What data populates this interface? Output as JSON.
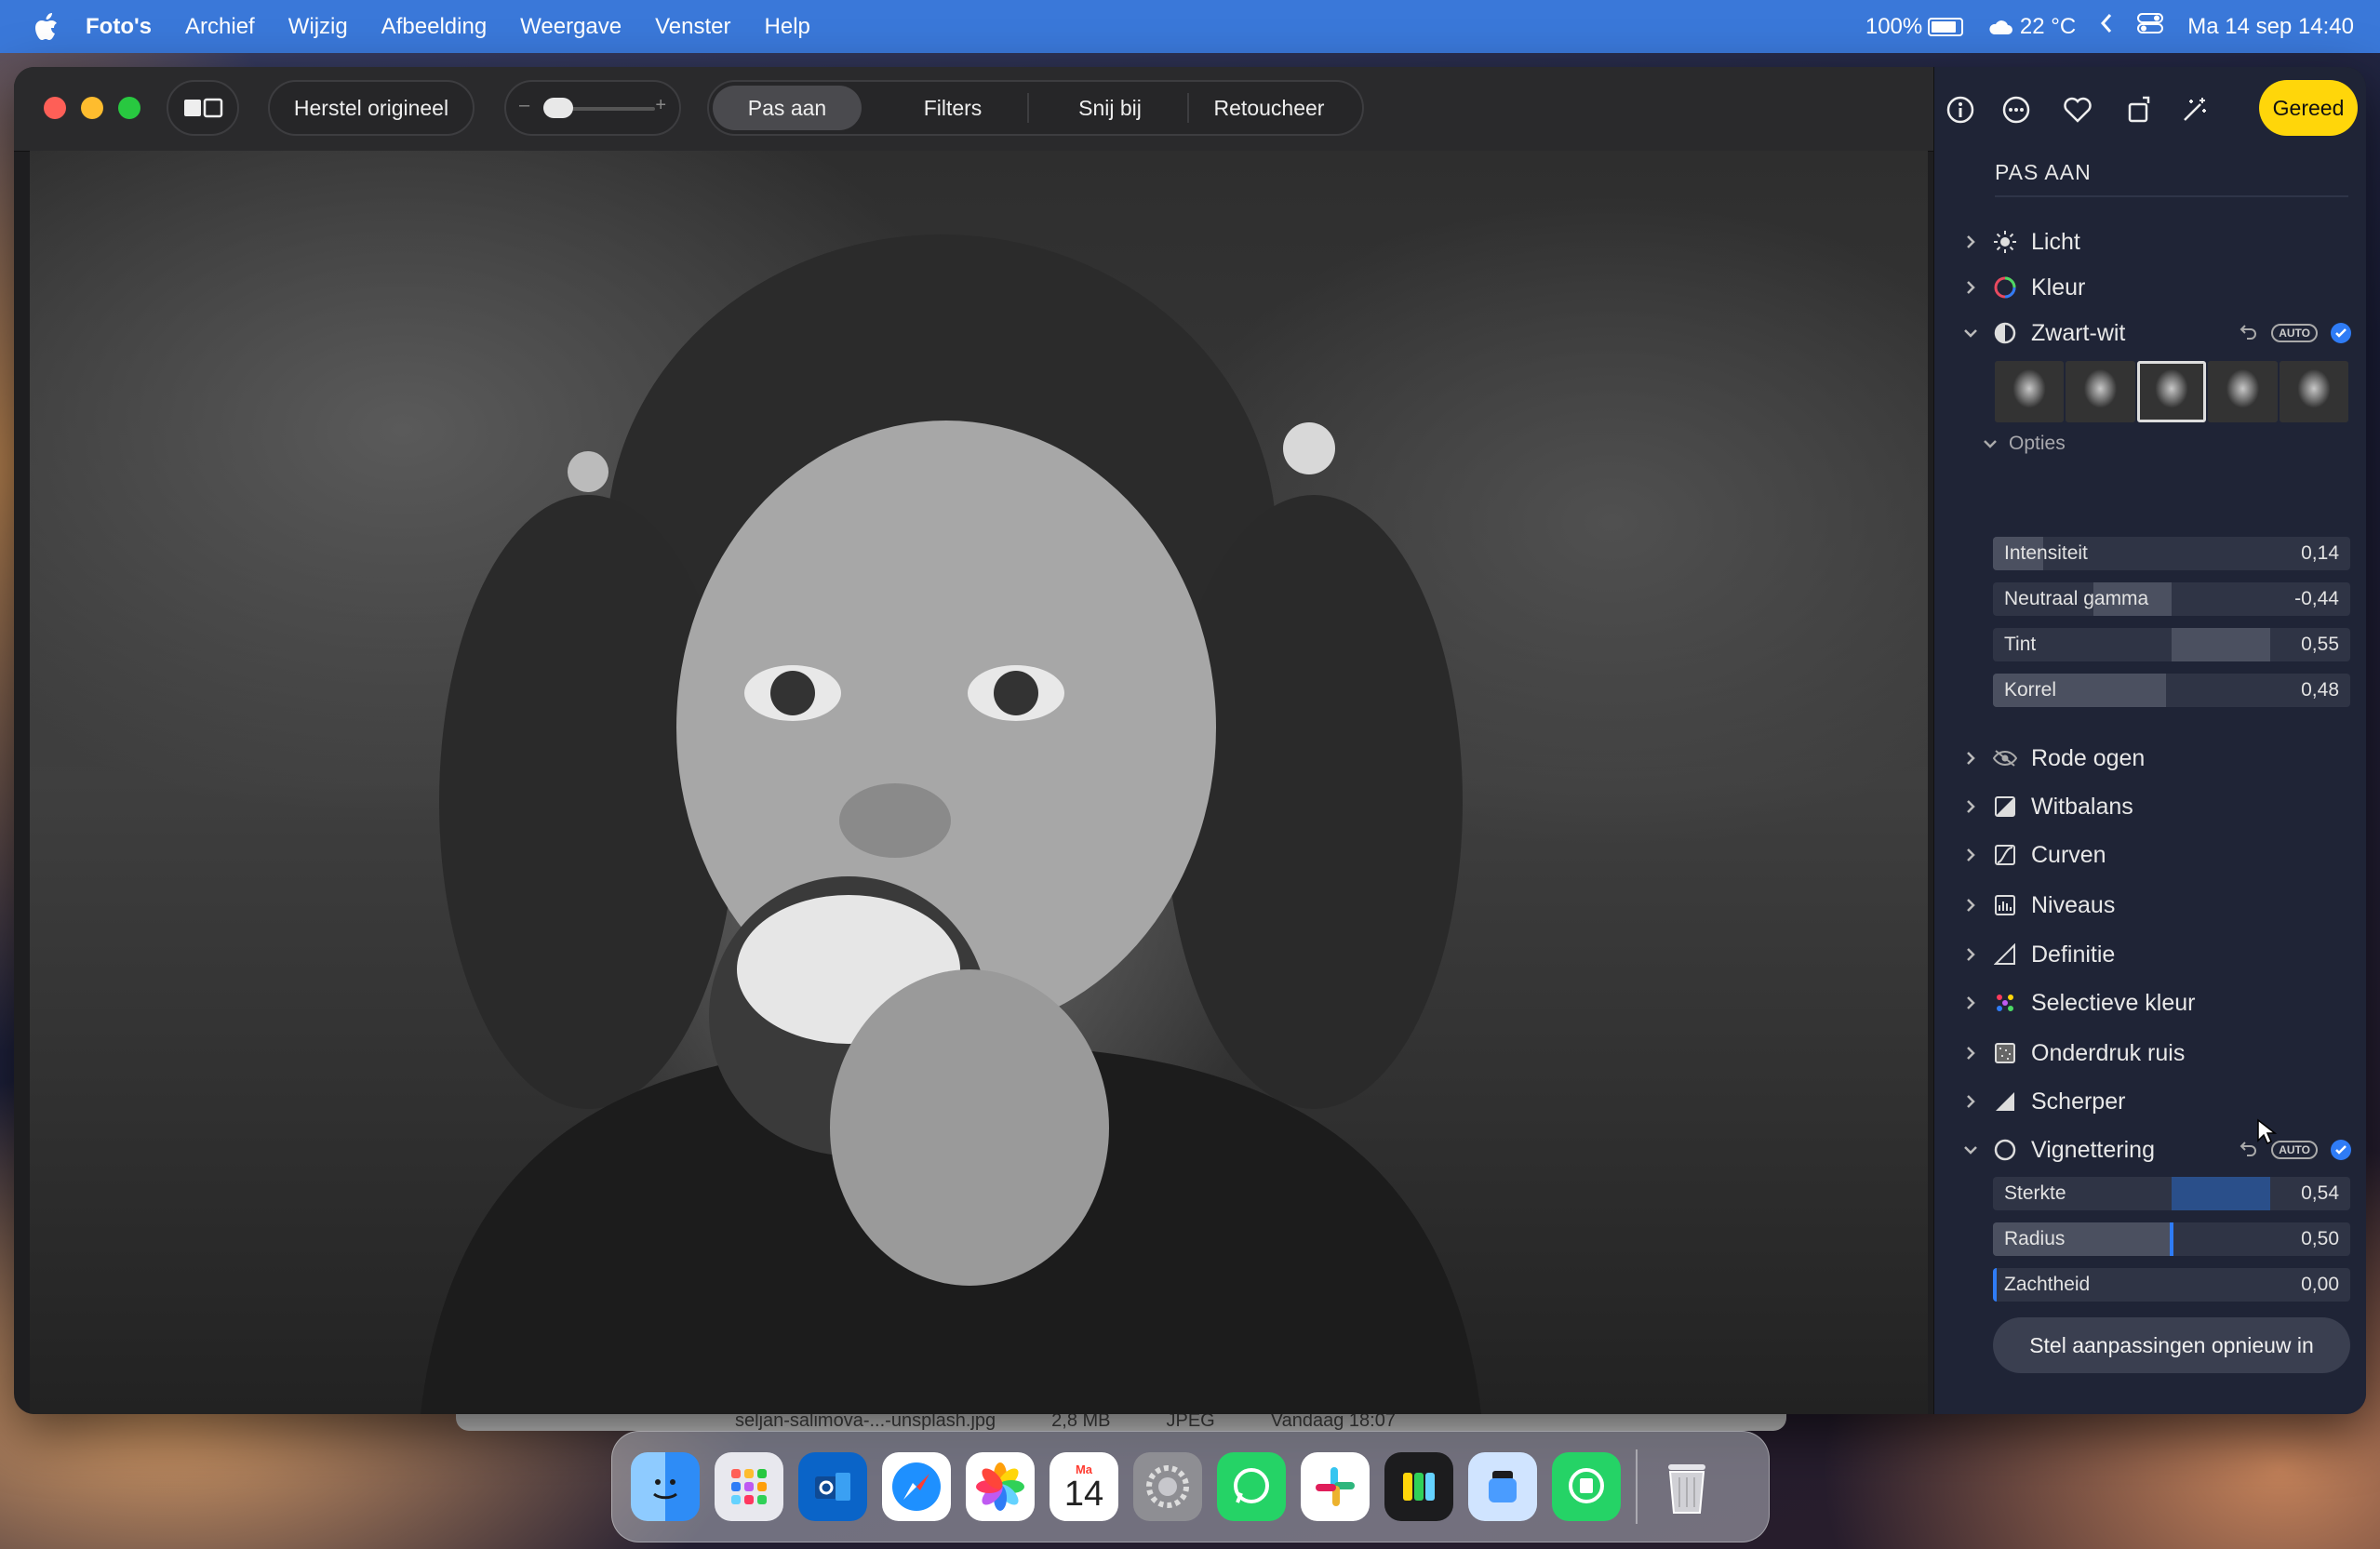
{
  "menubar": {
    "app_name": "Foto's",
    "items": [
      "Archief",
      "Wijzig",
      "Afbeelding",
      "Weergave",
      "Venster",
      "Help"
    ],
    "battery": "100%",
    "weather": "22 °C",
    "datetime": "Ma 14 sep  14:40"
  },
  "toolbar": {
    "revert_label": "Herstel origineel",
    "tabs": [
      "Pas aan",
      "Filters",
      "Snij bij",
      "Retoucheer"
    ],
    "active_tab": "Pas aan",
    "zoom_minus": "–",
    "zoom_plus": "+",
    "done_label": "Gereed"
  },
  "sidebar": {
    "title": "PAS AAN",
    "sections": [
      {
        "label": "Licht",
        "icon": "sun-icon"
      },
      {
        "label": "Kleur",
        "icon": "color-wheel-icon"
      },
      {
        "label": "Zwart-wit",
        "icon": "half-circle-icon",
        "expanded": true,
        "auto": "AUTO"
      }
    ],
    "bw_options_label": "Opties",
    "bw_sliders": [
      {
        "label": "Intensiteit",
        "value": "0,14"
      },
      {
        "label": "Neutraal gamma",
        "value": "-0,44"
      },
      {
        "label": "Tint",
        "value": "0,55"
      },
      {
        "label": "Korrel",
        "value": "0,48"
      }
    ],
    "sections2": [
      {
        "label": "Rode ogen",
        "icon": "eye-icon"
      },
      {
        "label": "Witbalans",
        "icon": "white-balance-icon"
      },
      {
        "label": "Curven",
        "icon": "curves-icon"
      },
      {
        "label": "Niveaus",
        "icon": "levels-icon"
      },
      {
        "label": "Definitie",
        "icon": "definition-icon"
      },
      {
        "label": "Selectieve kleur",
        "icon": "selective-color-icon"
      },
      {
        "label": "Onderdruk ruis",
        "icon": "noise-icon"
      },
      {
        "label": "Scherper",
        "icon": "sharpen-icon"
      },
      {
        "label": "Vignettering",
        "icon": "vignette-icon",
        "expanded": true,
        "auto": "AUTO"
      }
    ],
    "vignette_sliders": [
      {
        "label": "Sterkte",
        "value": "0,54"
      },
      {
        "label": "Radius",
        "value": "0,50"
      },
      {
        "label": "Zachtheid",
        "value": "0,00"
      }
    ],
    "reset_label": "Stel aanpassingen opnieuw in"
  },
  "behind_strip": {
    "filename": "seljan-salimova-...-unsplash.jpg",
    "size": "2,8 MB",
    "type": "JPEG",
    "date": "Vandaag 18:07"
  },
  "dock": {
    "apps": [
      "finder-icon",
      "launchpad-icon",
      "outlook-icon",
      "safari-icon",
      "photos-icon",
      "calendar-icon",
      "system-settings-icon",
      "whatsapp-icon",
      "slack-icon",
      "keynote-icon",
      "preview-icon",
      "whatsapp-business-icon",
      "trash-icon"
    ],
    "calendar_month": "Ma",
    "calendar_day": "14"
  },
  "colors": {
    "menubar": "#3a78d9",
    "accent_yellow": "#ffd60a",
    "accent_blue": "#2f7cf6"
  }
}
